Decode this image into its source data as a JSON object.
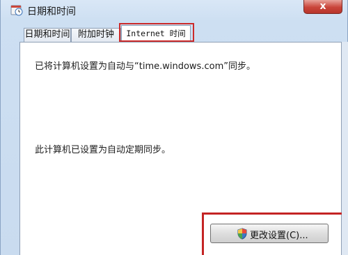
{
  "window": {
    "title": "日期和时间",
    "close_label": "x"
  },
  "tabs": [
    {
      "label": "日期和时间"
    },
    {
      "label": "附加时钟"
    },
    {
      "label": "Internet 时间"
    }
  ],
  "panel": {
    "sync_status": "已将计算机设置为自动与“time.windows.com”同步。",
    "schedule_status": "此计算机已设置为自动定期同步。",
    "change_button_label": "更改设置(C)..."
  },
  "colors": {
    "highlight": "#cc2a2a",
    "close": "#c9453a"
  }
}
